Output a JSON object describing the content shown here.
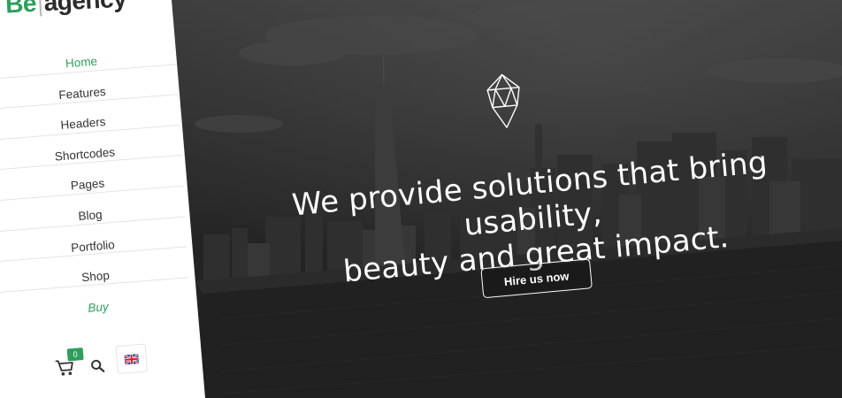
{
  "brand": {
    "part1": "Be",
    "part2": "agency"
  },
  "menu": {
    "items": [
      {
        "label": "Home",
        "state": "active"
      },
      {
        "label": "Features",
        "state": "normal"
      },
      {
        "label": "Headers",
        "state": "normal"
      },
      {
        "label": "Shortcodes",
        "state": "normal"
      },
      {
        "label": "Pages",
        "state": "normal"
      },
      {
        "label": "Blog",
        "state": "normal"
      },
      {
        "label": "Portfolio",
        "state": "normal"
      },
      {
        "label": "Shop",
        "state": "normal"
      },
      {
        "label": "Buy",
        "state": "highlight"
      }
    ]
  },
  "tools": {
    "cart_count": "0",
    "cart_icon": "cart-icon",
    "search_icon": "search-icon",
    "language_icon": "uk-flag-icon"
  },
  "hero": {
    "logo_icon": "geometric-diamond-icon",
    "headline_line1": "We provide solutions that bring usability,",
    "headline_line2": "beauty and great impact.",
    "cta_label": "Hire us now"
  },
  "colors": {
    "accent": "#2e9e5b",
    "sidebar_bg": "#ffffff",
    "hero_bg": "#333333",
    "text": "#333333"
  }
}
